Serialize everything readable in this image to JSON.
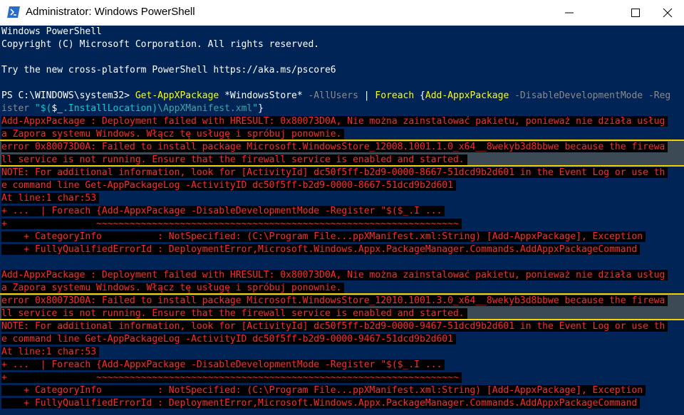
{
  "window": {
    "title": "Administrator: Windows PowerShell",
    "icon": "powershell-icon",
    "buttons": [
      "minimize-icon",
      "maximize-icon",
      "close-icon"
    ]
  },
  "colors": {
    "background": "#012456",
    "error_text": "#ff2a2a",
    "error_bg": "#000000",
    "highlight_border": "#f5d000",
    "command": "#ffff00"
  },
  "console": {
    "header": [
      "Windows PowerShell",
      "Copyright (C) Microsoft Corporation. All rights reserved.",
      "Try the new cross-platform PowerShell https://aka.ms/pscore6"
    ],
    "prompt": "PS C:\\WINDOWS\\system32> ",
    "command": {
      "cmd1": "Get-AppXPackage",
      "arg1": " *WindowsStore*",
      "param1": " -AllUsers",
      "pipe": " | ",
      "cmd2": "Foreach",
      "brace_open": " {",
      "cmd3": "Add-AppxPackage",
      "param2": " -DisableDevelopmentMode",
      "param3_part1": " -Reg",
      "param3_part2": "ister",
      "str_open": " \"$(",
      "var": "$_",
      "prop": ".InstallLocation)",
      "path": "\\AppXManifest.xml",
      "str_close": "\"",
      "brace_close": "}"
    },
    "blocks": [
      {
        "lines": [
          "Add-AppxPackage : Deployment failed with HRESULT: 0x80073D0A, Nie można zainstalować pakietu, ponieważ nie działa usług",
          "a Zapora systemu Windows. Włącz tę usługę i spróbuj ponownie."
        ],
        "highlighted": [
          "error 0x80073D0A: Failed to install package Microsoft.WindowsStore_12008.1001.1.0_x64__8wekyb3d8bbwe because the firewa",
          "ll service is not running. Ensure that the firewall service is enabled and started."
        ],
        "note": [
          "NOTE: For additional information, look for [ActivityId] dc50f5ff-b2d9-0000-8667-51dcd9b2d601 in the Event Log or use th",
          "e command line Get-AppPackageLog -ActivityID dc50f5ff-b2d9-0000-8667-51dcd9b2d601"
        ],
        "at_line": "At line:1 char:53",
        "snippet": "+ ...  | Foreach {Add-AppxPackage -DisableDevelopmentMode -Register \"$($_.I ...",
        "underline": "+                ~~~~~~~~~~~~~~~~~~~~~~~~~~~~~~~~~~~~~~~~~~~~~~~~~~~~~~~~~~~~~~~~~",
        "category": "    + CategoryInfo          : NotSpecified: (C:\\Program File...ppXManifest.xml:String) [Add-AppxPackage], Exception",
        "fqid": "    + FullyQualifiedErrorId : DeploymentError,Microsoft.Windows.Appx.PackageManager.Commands.AddAppxPackageCommand"
      },
      {
        "lines": [
          "Add-AppxPackage : Deployment failed with HRESULT: 0x80073D0A, Nie można zainstalować pakietu, ponieważ nie działa usług",
          "a Zapora systemu Windows. Włącz tę usługę i spróbuj ponownie."
        ],
        "highlighted": [
          "error 0x80073D0A: Failed to install package Microsoft.WindowsStore_12010.1001.3.0_x64__8wekyb3d8bbwe because the firewa",
          "ll service is not running. Ensure that the firewall service is enabled and started."
        ],
        "note": [
          "NOTE: For additional information, look for [ActivityId] dc50f5ff-b2d9-0000-9467-51dcd9b2d601 in the Event Log or use th",
          "e command line Get-AppPackageLog -ActivityID dc50f5ff-b2d9-0000-9467-51dcd9b2d601"
        ],
        "at_line": "At line:1 char:53",
        "snippet": "+ ...  | Foreach {Add-AppxPackage -DisableDevelopmentMode -Register \"$($_.I ...",
        "underline": "+                ~~~~~~~~~~~~~~~~~~~~~~~~~~~~~~~~~~~~~~~~~~~~~~~~~~~~~~~~~~~~~~~~~",
        "category": "    + CategoryInfo          : NotSpecified: (C:\\Program File...ppXManifest.xml:String) [Add-AppxPackage], Exception",
        "fqid": "    + FullyQualifiedErrorId : DeploymentError,Microsoft.Windows.Appx.PackageManager.Commands.AddAppxPackageCommand"
      }
    ]
  }
}
